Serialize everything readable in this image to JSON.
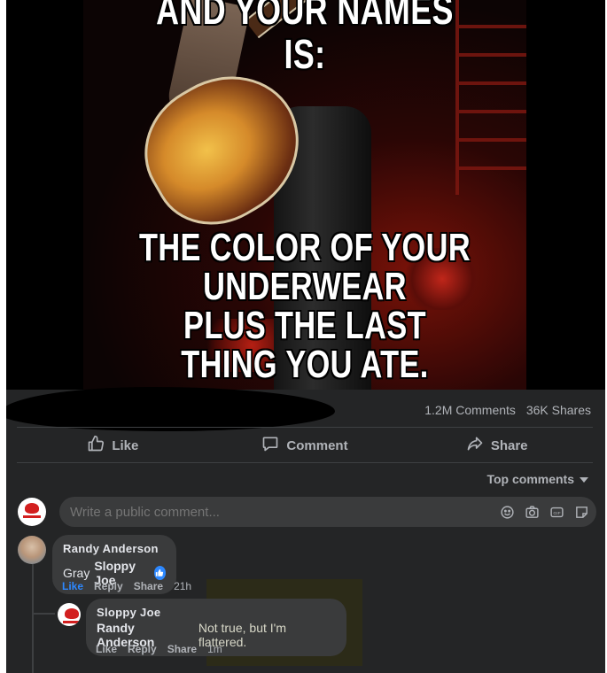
{
  "meme": {
    "caption_top": "AND YOUR NAMES IS:",
    "caption_bottom_line1": "THE COLOR OF YOUR UNDERWEAR",
    "caption_bottom_line2": "PLUS THE LAST THING YOU ATE."
  },
  "stats": {
    "comments": "1.2M Comments",
    "shares": "36K Shares"
  },
  "actions": {
    "like": "Like",
    "comment": "Comment",
    "share": "Share"
  },
  "sort": {
    "label": "Top comments"
  },
  "composer": {
    "placeholder": "Write a public comment..."
  },
  "comments": [
    {
      "author": "Randy Anderson",
      "text": "Gray",
      "mention": "Sloppy Joe",
      "like": "Like",
      "reply": "Reply",
      "share": "Share",
      "time": "21h",
      "liked": true
    },
    {
      "author": "Sloppy Joe",
      "mention": "Randy Anderson",
      "text": "Not true, but I'm flattered.",
      "like": "Like",
      "reply": "Reply",
      "share": "Share",
      "time": "1m"
    }
  ],
  "colors": {
    "surface": "#242526",
    "bubble": "#3a3b3c",
    "text_primary": "#e4e6eb",
    "text_secondary": "#b0b3b8",
    "accent": "#2d88ff"
  },
  "icons": [
    "like-icon",
    "comment-icon",
    "share-icon",
    "emoji-icon",
    "camera-icon",
    "gif-icon",
    "sticker-icon",
    "thumbs-up-react-icon"
  ]
}
